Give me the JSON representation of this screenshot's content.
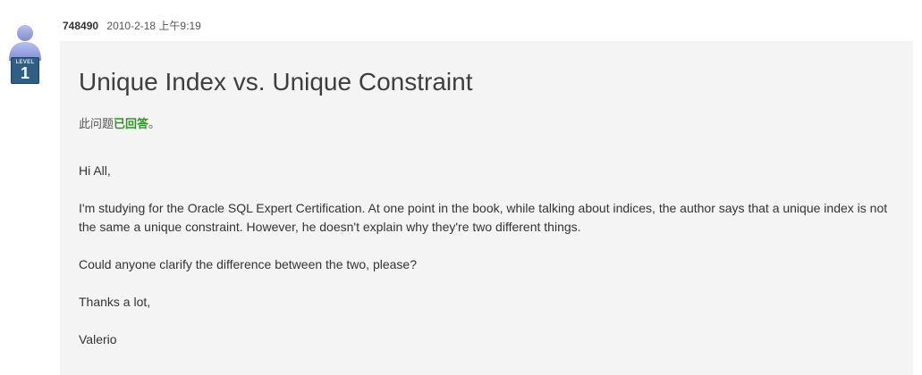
{
  "author": {
    "username": "748490",
    "timestamp": "2010-2-18 上午9:19",
    "level_label": "LEVEL",
    "level_value": "1"
  },
  "post": {
    "title": "Unique Index vs. Unique Constraint",
    "status_prefix": "此问题",
    "status_link": "已回答",
    "status_suffix": "。",
    "paragraphs": [
      "Hi All,",
      "I'm studying for the Oracle SQL Expert Certification. At one point in the book, while talking about indices, the author says that a unique index is not the same a unique constraint. However, he doesn't explain why they're two different things.",
      "Could anyone clarify the difference between the two, please?",
      "Thanks a lot,",
      "Valerio"
    ]
  },
  "colors": {
    "answered_green": "#2a9a1f",
    "content_bg": "#f4f4f4",
    "badge_blue": "#2f5f85"
  },
  "icons": {
    "avatar": "user-avatar-icon",
    "level": "level-badge-icon"
  }
}
